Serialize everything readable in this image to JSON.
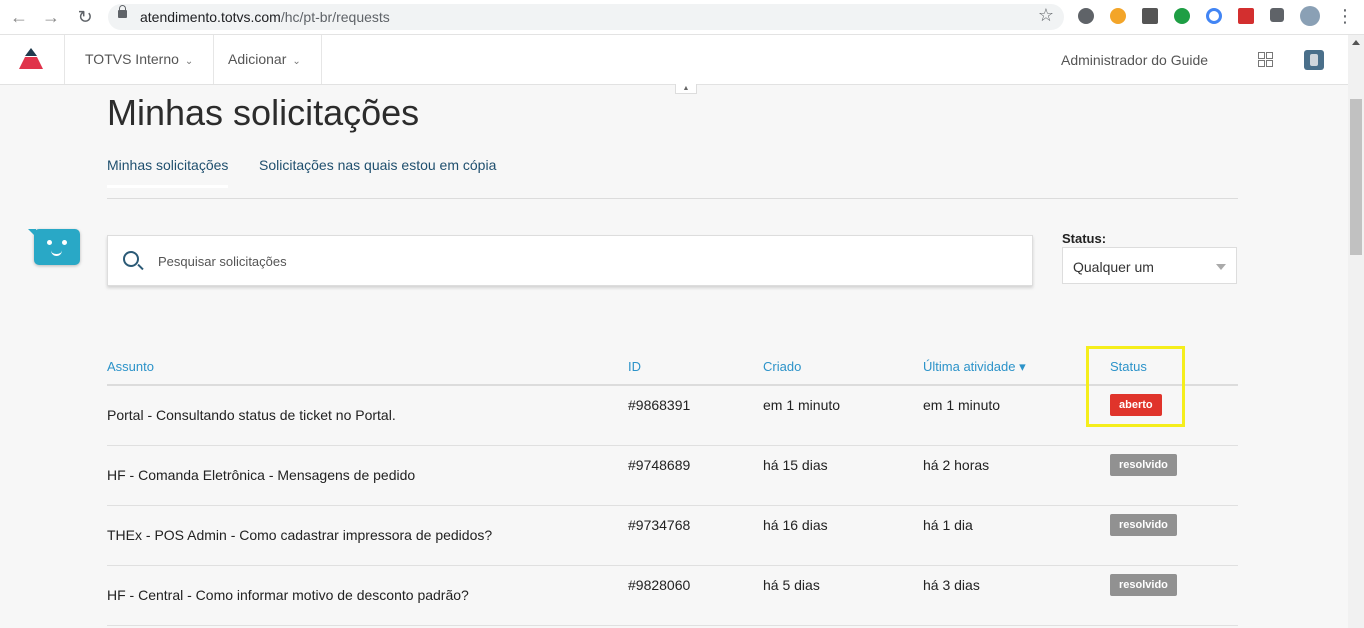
{
  "browser": {
    "url_host": "atendimento.totvs.com",
    "url_path": "/hc/pt-br/requests"
  },
  "header": {
    "menu": [
      {
        "label": "TOTVS Interno"
      },
      {
        "label": "Adicionar"
      }
    ],
    "user_name": "Administrador do Guide"
  },
  "page": {
    "title": "Minhas solicitações",
    "tabs": [
      {
        "label": "Minhas solicitações"
      },
      {
        "label": "Solicitações nas quais estou em cópia"
      }
    ],
    "search": {
      "placeholder": "Pesquisar solicitações",
      "value": ""
    },
    "status_filter": {
      "label": "Status:",
      "selected": "Qualquer um"
    }
  },
  "table": {
    "columns": [
      "Assunto",
      "ID",
      "Criado",
      "Última atividade ▾",
      "Status"
    ],
    "rows": [
      {
        "subject": "Portal - Consultando status de ticket no Portal.",
        "id": "#9868391",
        "created": "em 1 minuto",
        "last_activity": "em 1 minuto",
        "status": "aberto",
        "status_color": "#e0342b"
      },
      {
        "subject": "HF - Comanda Eletrônica - Mensagens de pedido",
        "id": "#9748689",
        "created": "há 15 dias",
        "last_activity": "há 2 horas",
        "status": "resolvido",
        "status_color": "#919191"
      },
      {
        "subject": "THEx - POS Admin - Como cadastrar impressora de pedidos?",
        "id": "#9734768",
        "created": "há 16 dias",
        "last_activity": "há 1 dia",
        "status": "resolvido",
        "status_color": "#919191"
      },
      {
        "subject": "HF - Central - Como informar motivo de desconto padrão?",
        "id": "#9828060",
        "created": "há 5 dias",
        "last_activity": "há 3 dias",
        "status": "resolvido",
        "status_color": "#919191"
      }
    ]
  },
  "colors": {
    "link": "#2c93c9",
    "tab_text": "#1f4f6e",
    "bot": "#29a8c6",
    "highlight": "#f5ee1c",
    "logo_red": "#e0344b",
    "logo_dark": "#1f3a4d"
  }
}
